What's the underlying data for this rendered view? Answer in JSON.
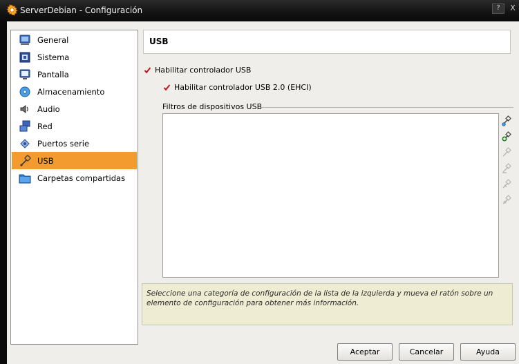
{
  "window": {
    "title": "ServerDebian - Configuración",
    "help_label": "?",
    "close_label": "X"
  },
  "sidebar": {
    "items": [
      {
        "label": "General",
        "icon": "general-icon"
      },
      {
        "label": "Sistema",
        "icon": "system-icon"
      },
      {
        "label": "Pantalla",
        "icon": "display-icon"
      },
      {
        "label": "Almacenamiento",
        "icon": "storage-icon"
      },
      {
        "label": "Audio",
        "icon": "audio-icon"
      },
      {
        "label": "Red",
        "icon": "network-icon"
      },
      {
        "label": "Puertos serie",
        "icon": "serial-ports-icon"
      },
      {
        "label": "USB",
        "icon": "usb-icon",
        "selected": true
      },
      {
        "label": "Carpetas compartidas",
        "icon": "shared-folders-icon"
      }
    ]
  },
  "main": {
    "header": "USB",
    "enable_usb_label": "Habilitar controlador USB",
    "enable_usb_checked": true,
    "enable_usb2_label": "Habilitar controlador USB 2.0 (EHCI)",
    "enable_usb2_checked": true,
    "filters_label": "Filtros de dispositivos USB",
    "filters": []
  },
  "info": {
    "text": "Seleccione una categoría de configuración de la lista de la izquierda y mueva el ratón sobre un elemento de configuración para obtener más información."
  },
  "buttons": {
    "ok": "Aceptar",
    "cancel": "Cancelar",
    "help": "Ayuda"
  },
  "colors": {
    "selection": "#f39b2e",
    "check": "#c0161b",
    "info_bg": "#eeedd3"
  }
}
